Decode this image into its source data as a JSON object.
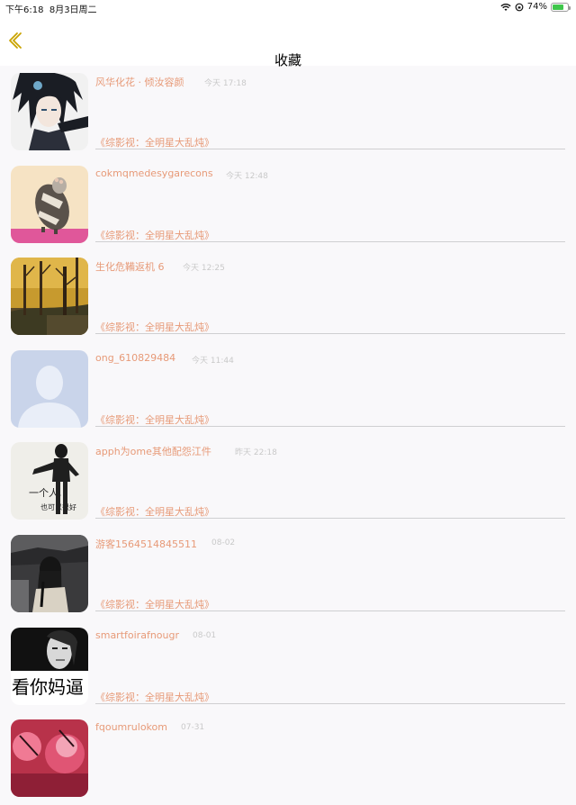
{
  "status_bar": {
    "time": "下午6:18",
    "date": "8月3日周二",
    "battery": "74%",
    "battery_level": 0.74,
    "colors": {
      "battery_fill": "#3fc64b"
    }
  },
  "nav": {
    "title": "收藏",
    "back_icon": "chevron-left-icon",
    "colors": {
      "back_icon": "#c9a300"
    }
  },
  "colors": {
    "accent_text": "#e79a78",
    "time_text": "#c9c9c9",
    "divider": "#cfcfd1"
  },
  "items": [
    {
      "name": "风华化花 · 倾汝容颜",
      "time": "今天 17:18",
      "subtitle": "《综影视：全明星大乱炖》",
      "avatar": "anime-character-avatar"
    },
    {
      "name": "cokmqmedesygarecons",
      "time": "今天 12:48",
      "subtitle": "《综影视：全明星大乱炖》",
      "avatar": "guinea-pig-avatar"
    },
    {
      "name": "生化危鞴返机 6",
      "time": "今天 12:25",
      "subtitle": "《综影视：全明星大乱炖》",
      "avatar": "autumn-trees-avatar"
    },
    {
      "name": "ong_610829484",
      "time": "今天 11:44",
      "subtitle": "《综影视：全明星大乱炖》",
      "avatar": "default-person-avatar"
    },
    {
      "name": "apph为ome其他配怨江件",
      "time": "昨天 22:18",
      "subtitle": "《综影视：全明星大乱炖》",
      "avatar": "sketch-person-avatar",
      "avatar_text": [
        "一个人,",
        "也可以很好"
      ]
    },
    {
      "name": "游客1564514845511",
      "time": "08-02",
      "subtitle": "《综影视：全明星大乱炖》",
      "avatar": "dark-girl-avatar"
    },
    {
      "name": "smartfoirafnougr",
      "time": "08-01",
      "subtitle": "《综影视：全明星大乱炖》",
      "avatar": "meme-face-avatar",
      "avatar_text": [
        "看你妈逼"
      ]
    },
    {
      "name": "fqoumrulokom",
      "time": "07-31",
      "subtitle": "",
      "avatar": "drinks-avatar"
    }
  ]
}
